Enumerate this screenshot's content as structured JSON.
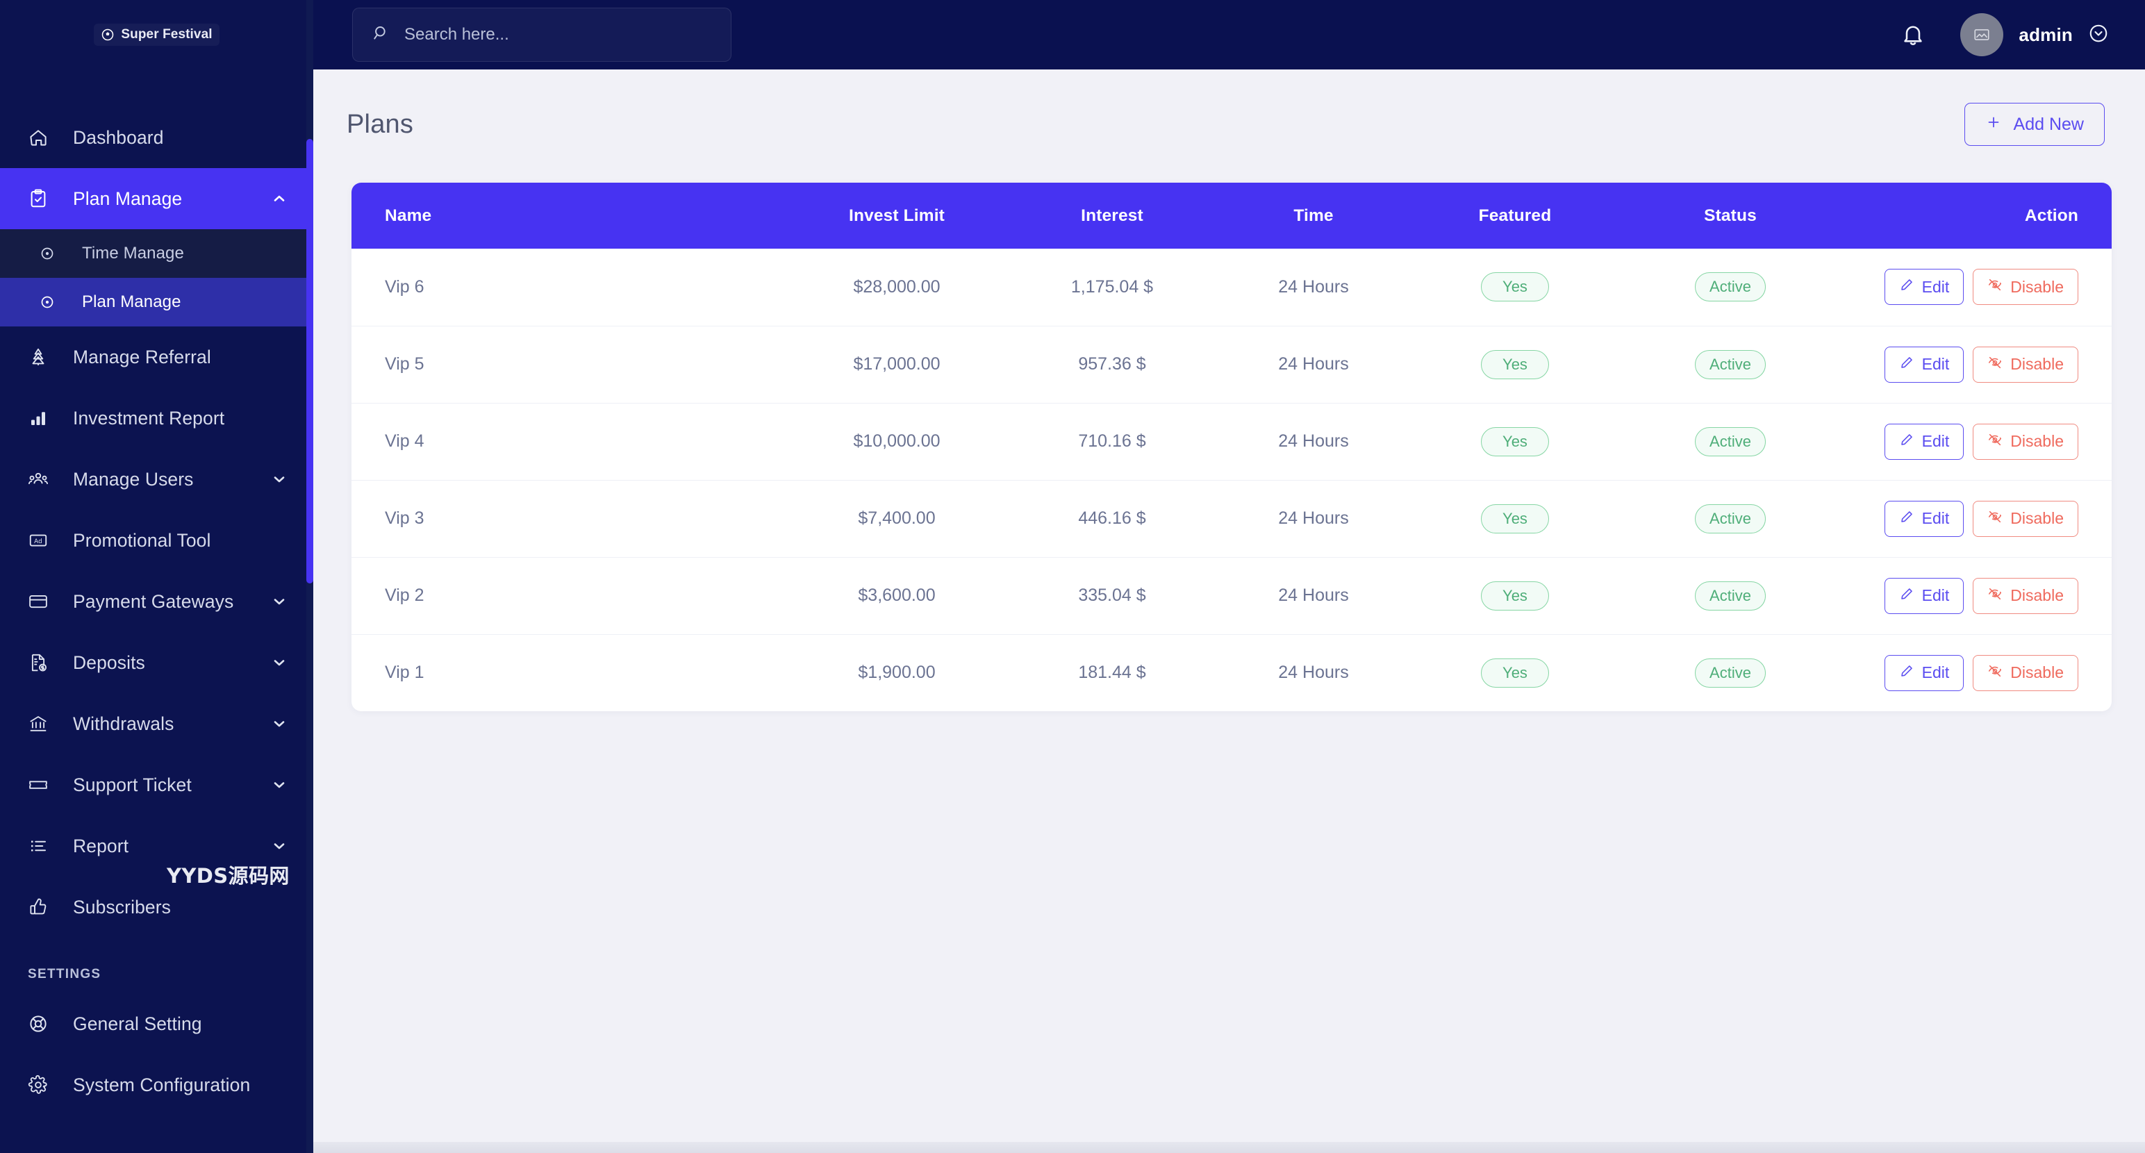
{
  "brand": {
    "name": "Super Festival",
    "logo_icon": "soccer-ball-icon"
  },
  "colors": {
    "sidebar_bg": "#0c1350",
    "topbar_bg": "#0a1150",
    "accent": "#4733f2",
    "accent_outline": "#5b4df0",
    "danger": "#ef6a5d",
    "success": "#4fae79",
    "page_bg": "#f1f1f7"
  },
  "search": {
    "value": "",
    "placeholder": "Search here...",
    "icon": "search-icon"
  },
  "topbar": {
    "notification_icon": "bell-icon",
    "avatar_icon": "image-placeholder-icon",
    "username": "admin",
    "user_menu_icon": "chevron-down-circle-icon"
  },
  "sidebar": {
    "items": [
      {
        "label": "Dashboard",
        "icon": "home-icon",
        "active": false,
        "caret": ""
      },
      {
        "label": "Plan Manage",
        "icon": "clipboard-check-icon",
        "active": true,
        "caret": "up"
      },
      {
        "label": "Time Manage",
        "icon": "circle-dot-icon",
        "sub": true,
        "active": false,
        "caret": ""
      },
      {
        "label": "Plan Manage",
        "icon": "circle-dot-icon",
        "sub": true,
        "active": true,
        "caret": ""
      },
      {
        "label": "Manage Referral",
        "icon": "referral-tree-icon",
        "active": false,
        "caret": ""
      },
      {
        "label": "Investment Report",
        "icon": "bar-chart-icon",
        "active": false,
        "caret": ""
      },
      {
        "label": "Manage Users",
        "icon": "users-icon",
        "active": false,
        "caret": "down"
      },
      {
        "label": "Promotional Tool",
        "icon": "ad-icon",
        "active": false,
        "caret": ""
      },
      {
        "label": "Payment Gateways",
        "icon": "credit-card-icon",
        "active": false,
        "caret": "down"
      },
      {
        "label": "Deposits",
        "icon": "file-dollar-icon",
        "active": false,
        "caret": "down"
      },
      {
        "label": "Withdrawals",
        "icon": "bank-icon",
        "active": false,
        "caret": "down"
      },
      {
        "label": "Support Ticket",
        "icon": "ticket-icon",
        "active": false,
        "caret": "down"
      },
      {
        "label": "Report",
        "icon": "list-icon",
        "active": false,
        "caret": "down"
      },
      {
        "label": "Subscribers",
        "icon": "thumbs-up-icon",
        "active": false,
        "caret": ""
      }
    ],
    "section_label": "SETTINGS",
    "settings_items": [
      {
        "label": "General Setting",
        "icon": "lifebuoy-icon",
        "active": false,
        "caret": ""
      },
      {
        "label": "System Configuration",
        "icon": "gear-icon",
        "active": false,
        "caret": ""
      }
    ]
  },
  "page": {
    "title": "Plans",
    "add_new_label": "Add New",
    "add_new_icon": "plus-icon"
  },
  "table": {
    "columns": [
      "Name",
      "Invest Limit",
      "Interest",
      "Time",
      "Featured",
      "Status",
      "Action"
    ],
    "rows": [
      {
        "name": "Vip 6",
        "invest_limit": "$28,000.00",
        "interest": "1,175.04 $",
        "time": "24 Hours",
        "featured": "Yes",
        "status": "Active"
      },
      {
        "name": "Vip 5",
        "invest_limit": "$17,000.00",
        "interest": "957.36 $",
        "time": "24 Hours",
        "featured": "Yes",
        "status": "Active"
      },
      {
        "name": "Vip 4",
        "invest_limit": "$10,000.00",
        "interest": "710.16 $",
        "time": "24 Hours",
        "featured": "Yes",
        "status": "Active"
      },
      {
        "name": "Vip 3",
        "invest_limit": "$7,400.00",
        "interest": "446.16 $",
        "time": "24 Hours",
        "featured": "Yes",
        "status": "Active"
      },
      {
        "name": "Vip 2",
        "invest_limit": "$3,600.00",
        "interest": "335.04 $",
        "time": "24 Hours",
        "featured": "Yes",
        "status": "Active"
      },
      {
        "name": "Vip 1",
        "invest_limit": "$1,900.00",
        "interest": "181.44 $",
        "time": "24 Hours",
        "featured": "Yes",
        "status": "Active"
      }
    ],
    "edit_label": "Edit",
    "edit_icon": "pencil-icon",
    "disable_label": "Disable",
    "disable_icon": "eye-off-icon"
  },
  "watermark": {
    "text": "YYDS源码网"
  }
}
